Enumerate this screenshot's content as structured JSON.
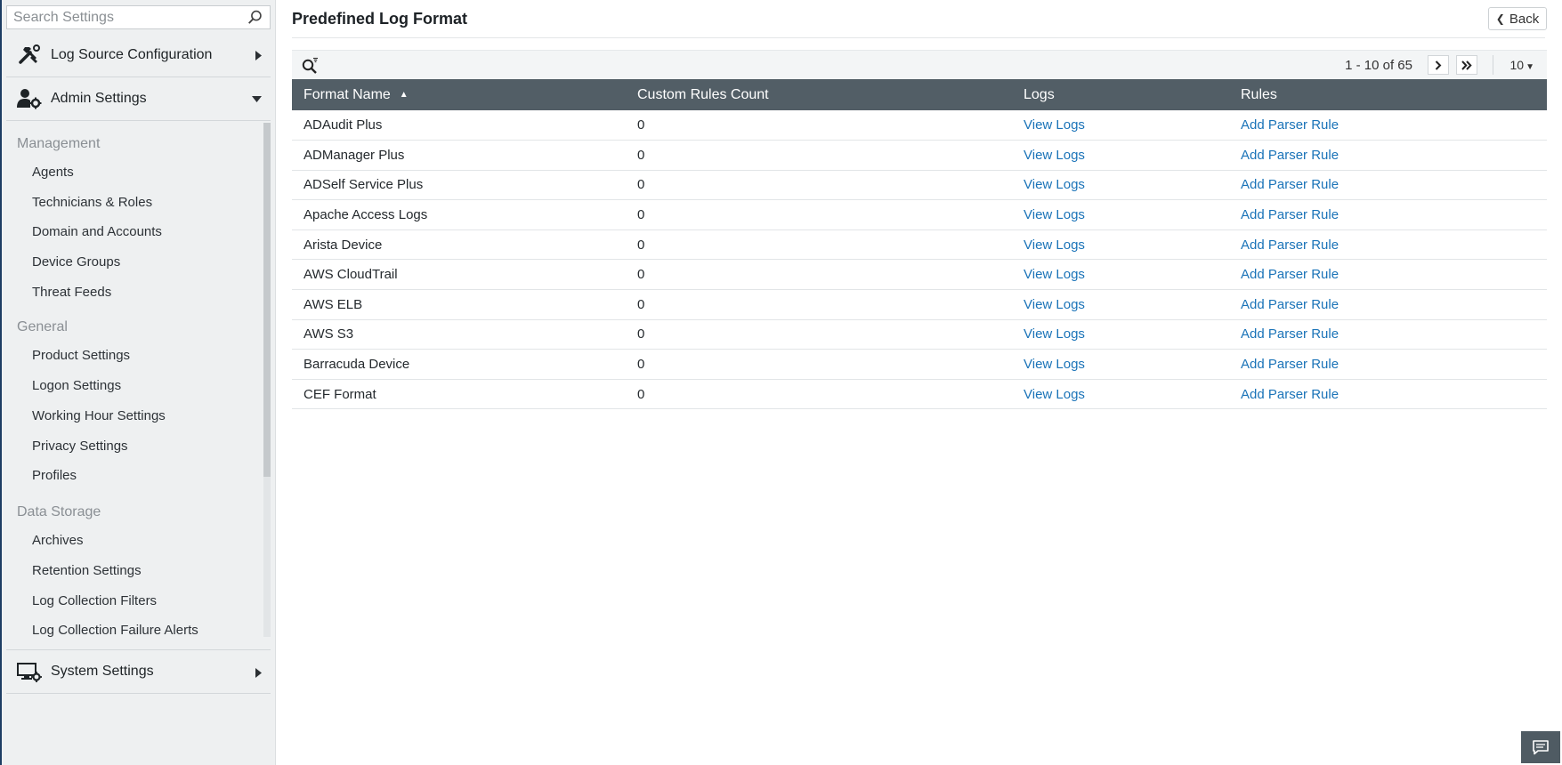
{
  "sidebar": {
    "search_placeholder": "Search Settings",
    "sections": {
      "log_source": "Log Source Configuration",
      "admin": "Admin Settings",
      "system": "System Settings"
    },
    "groups": [
      {
        "title": "Management",
        "items": [
          "Agents",
          "Technicians & Roles",
          "Domain and Accounts",
          "Device Groups",
          "Threat Feeds"
        ]
      },
      {
        "title": "General",
        "items": [
          "Product Settings",
          "Logon Settings",
          "Working Hour Settings",
          "Privacy Settings",
          "Profiles"
        ]
      },
      {
        "title": "Data Storage",
        "items": [
          "Archives",
          "Retention Settings",
          "Log Collection Filters",
          "Log Collection Failure Alerts"
        ]
      }
    ]
  },
  "header": {
    "title": "Predefined Log Format",
    "back_label": "Back"
  },
  "pager": {
    "range_text": "1 - 10 of 65",
    "per_page": "10"
  },
  "table": {
    "columns": [
      "Format Name",
      "Custom Rules Count",
      "Logs",
      "Rules"
    ],
    "rows": [
      {
        "name": "ADAudit Plus",
        "count": "0",
        "logs": "View Logs",
        "rules": "Add Parser Rule"
      },
      {
        "name": "ADManager Plus",
        "count": "0",
        "logs": "View Logs",
        "rules": "Add Parser Rule"
      },
      {
        "name": "ADSelf Service Plus",
        "count": "0",
        "logs": "View Logs",
        "rules": "Add Parser Rule"
      },
      {
        "name": "Apache Access Logs",
        "count": "0",
        "logs": "View Logs",
        "rules": "Add Parser Rule"
      },
      {
        "name": "Arista Device",
        "count": "0",
        "logs": "View Logs",
        "rules": "Add Parser Rule"
      },
      {
        "name": "AWS CloudTrail",
        "count": "0",
        "logs": "View Logs",
        "rules": "Add Parser Rule"
      },
      {
        "name": "AWS ELB",
        "count": "0",
        "logs": "View Logs",
        "rules": "Add Parser Rule"
      },
      {
        "name": "AWS S3",
        "count": "0",
        "logs": "View Logs",
        "rules": "Add Parser Rule"
      },
      {
        "name": "Barracuda Device",
        "count": "0",
        "logs": "View Logs",
        "rules": "Add Parser Rule"
      },
      {
        "name": "CEF Format",
        "count": "0",
        "logs": "View Logs",
        "rules": "Add Parser Rule"
      }
    ]
  },
  "colors": {
    "table_header_bg": "#525e66",
    "link": "#1a73b8",
    "sidebar_bg": "#eef0f1"
  },
  "icons": {
    "log_source": "tools-icon",
    "admin": "user-gear-icon",
    "system": "monitor-gear-icon",
    "search": "search-icon",
    "filter": "search-filter-icon",
    "chat": "chat-icon"
  }
}
